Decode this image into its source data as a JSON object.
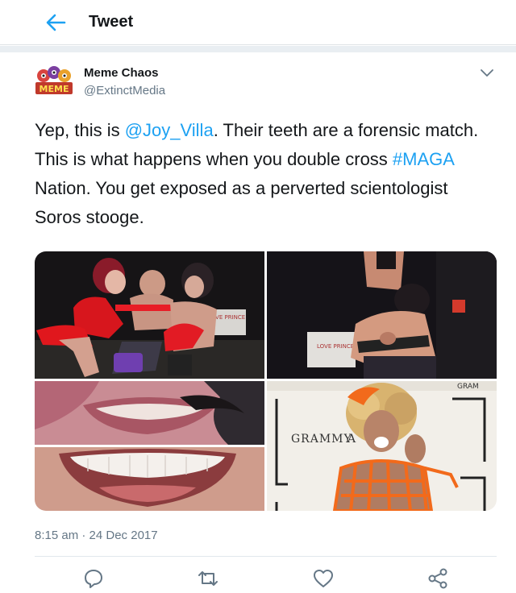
{
  "header": {
    "title": "Tweet",
    "back_icon": "back-arrow-icon"
  },
  "tweet": {
    "author_name": "Meme Chaos",
    "handle": "@ExtinctMedia",
    "avatar_text": "MEME",
    "text_parts": {
      "p1": "Yep, this is ",
      "mention": "@Joy_Villa",
      "p2": ". Their teeth are a forensic match. This is what happens when you double cross ",
      "hashtag": "#MAGA",
      "p3": " Nation. You get exposed as a perverted scientologist Soros stooge."
    },
    "timestamp": "8:15 am · 24 Dec 2017"
  },
  "media": {
    "grammy_text": "GRAMMY",
    "grammy_text_partial": "A",
    "backdrop_text_top": "GRAM",
    "box_text_1": "LOVE PRINCE",
    "box_text_2": "LOVE PRINCE"
  },
  "actions": [
    "reply-icon",
    "retweet-icon",
    "like-icon",
    "share-icon"
  ],
  "colors": {
    "link": "#1da1f2",
    "icon": "#657786",
    "accent_orange": "#f26a1b"
  }
}
